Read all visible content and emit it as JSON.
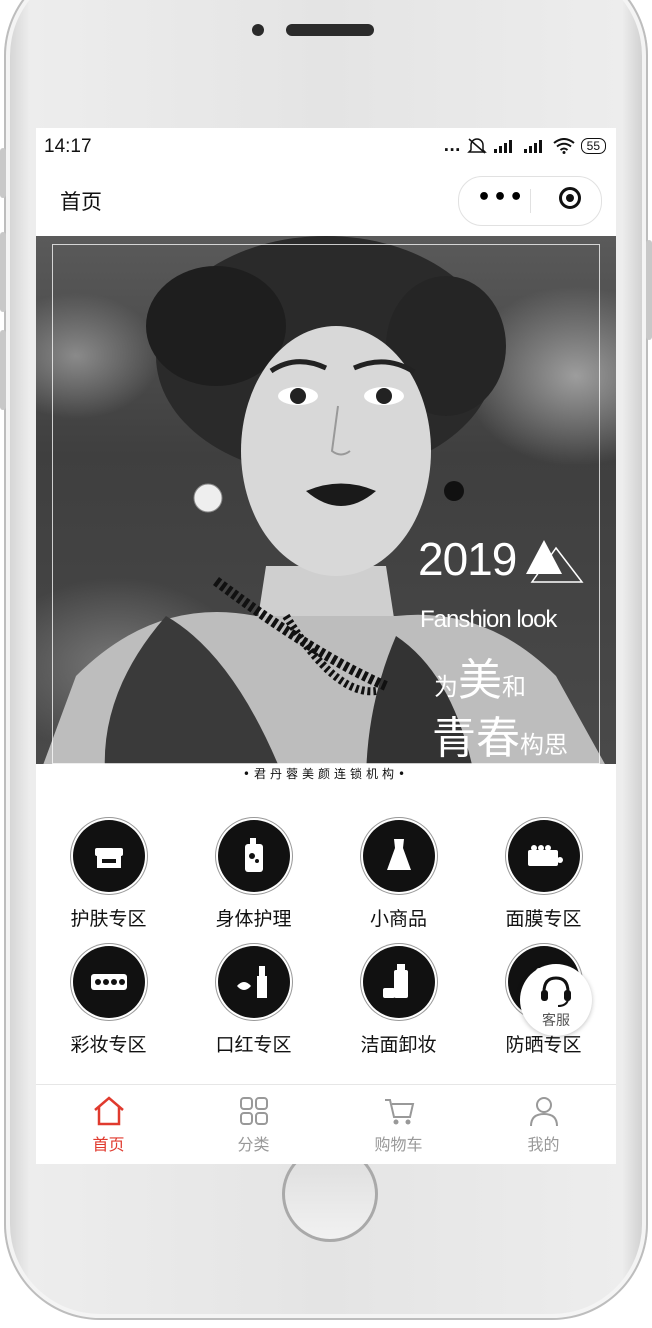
{
  "status_bar": {
    "time": "14:17",
    "signal_dots": "...",
    "battery": "55"
  },
  "navbar": {
    "title": "首页",
    "more_label": "•••"
  },
  "banner": {
    "year": "2019",
    "subtitle": "Fanshion look",
    "line1": {
      "a": "为",
      "b": "美",
      "c": "和"
    },
    "line2": {
      "a": "青春",
      "b": "构思"
    },
    "caption": "•君丹蓉美颜连锁机构•"
  },
  "categories": [
    {
      "label": "护肤专区",
      "icon": "cream-jar-icon"
    },
    {
      "label": "身体护理",
      "icon": "lotion-bottle-icon"
    },
    {
      "label": "小商品",
      "icon": "dress-icon"
    },
    {
      "label": "面膜专区",
      "icon": "mask-tray-icon"
    },
    {
      "label": "彩妆专区",
      "icon": "eyeshadow-palette-icon"
    },
    {
      "label": "口红专区",
      "icon": "lipstick-icon"
    },
    {
      "label": "洁面卸妆",
      "icon": "cleanser-bottle-icon"
    },
    {
      "label": "防晒专区",
      "icon": "sunscreen-icon"
    }
  ],
  "service_button": {
    "label": "客服",
    "icon": "headset-icon"
  },
  "tabbar": [
    {
      "label": "首页",
      "icon": "home-icon",
      "active": true
    },
    {
      "label": "分类",
      "icon": "grid-icon",
      "active": false
    },
    {
      "label": "购物车",
      "icon": "cart-icon",
      "active": false
    },
    {
      "label": "我的",
      "icon": "user-icon",
      "active": false
    }
  ],
  "colors": {
    "accent": "#e03a2e",
    "inactive": "#999999",
    "icon_bg": "#111111"
  }
}
